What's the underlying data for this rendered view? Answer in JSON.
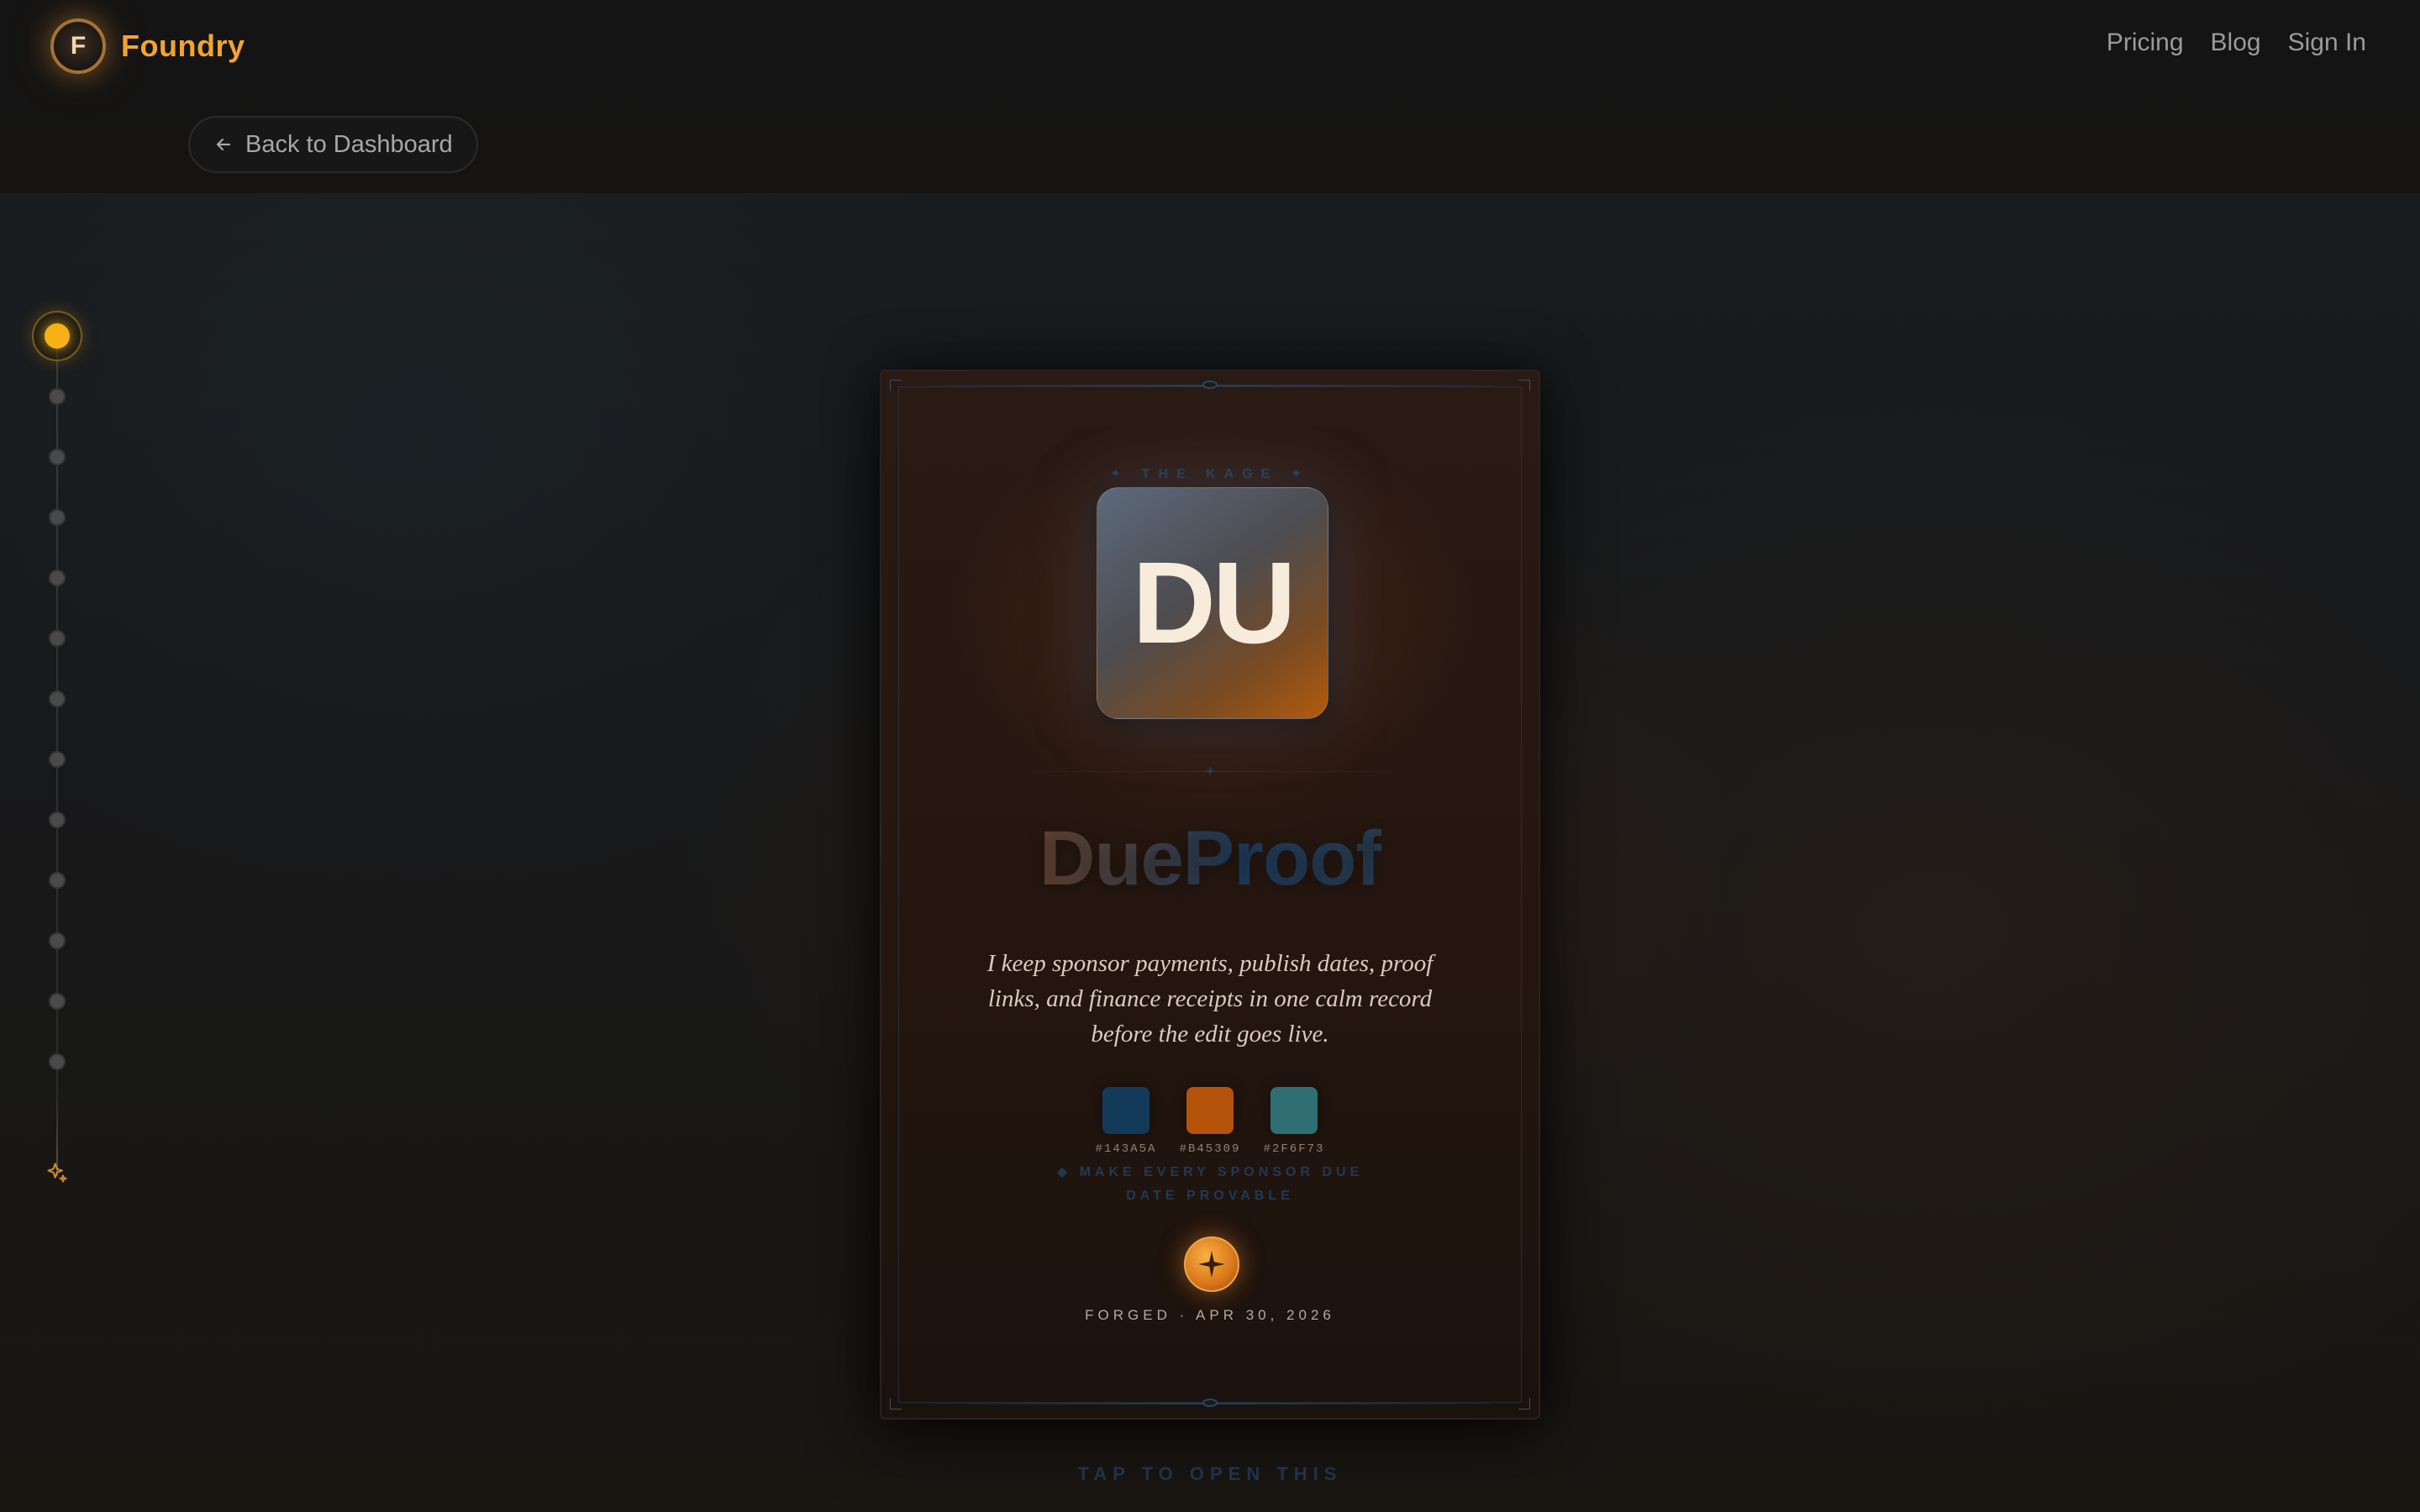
{
  "header": {
    "logo_letter": "F",
    "brand": "Foundry",
    "nav": [
      "Pricing",
      "Blog",
      "Sign In"
    ],
    "back_label": "Back to Dashboard"
  },
  "rail": {
    "total_steps": 13,
    "active_step": 1
  },
  "card": {
    "eyebrow": "✦ THE KAGE ✦",
    "monogram": "DU",
    "product_name": "DueProof",
    "tagline": "I keep sponsor payments, publish dates, proof links, and finance receipts in one calm record before the edit goes live.",
    "swatches": [
      {
        "hex": "#143A5A",
        "label": "#143A5A"
      },
      {
        "hex": "#B45309",
        "label": "#B45309"
      },
      {
        "hex": "#2F6F73",
        "label": "#2F6F73"
      }
    ],
    "motto": "◆ MAKE EVERY SPONSOR DUE DATE PROVABLE",
    "forged": "FORGED · APR 30, 2026"
  },
  "footer_hint": "TAP TO OPEN THIS",
  "colors": {
    "accent": "#F2A430",
    "active_step": "#F6B117",
    "background": "#17191B"
  },
  "icons": {
    "back": "arrow-left-icon",
    "rail_end": "sparkle-icon",
    "seal": "four-point-star-icon"
  }
}
